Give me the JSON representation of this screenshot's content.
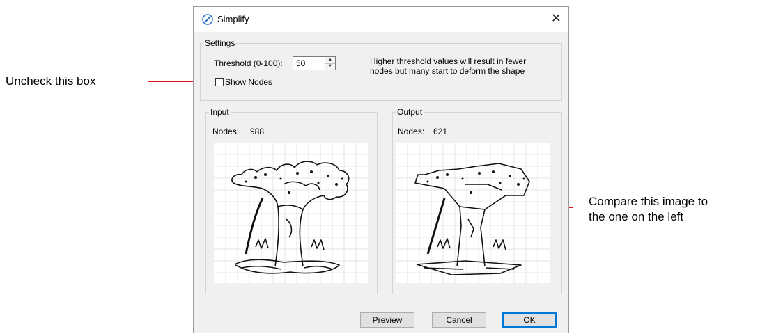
{
  "annotations": {
    "left_callout": "Uncheck this box",
    "right_callout_line1": "Compare this image to",
    "right_callout_line2": "the one on the left"
  },
  "dialog": {
    "title": "Simplify",
    "close_glyph": "✕",
    "title_icon": "compass-icon"
  },
  "settings": {
    "legend": "Settings",
    "threshold_label": "Threshold (0-100):",
    "threshold_value": "50",
    "show_nodes_label": "Show Nodes",
    "show_nodes_checked": false,
    "hint_line1": "Higher threshold values will result in fewer",
    "hint_line2": "nodes but many start to deform the shape"
  },
  "input": {
    "legend": "Input",
    "nodes_label": "Nodes:",
    "nodes_value": "988"
  },
  "output": {
    "legend": "Output",
    "nodes_label": "Nodes:",
    "nodes_value": "621"
  },
  "buttons": {
    "preview": "Preview",
    "cancel": "Cancel",
    "ok": "OK"
  },
  "colors": {
    "arrow": "#e8141b",
    "dialog_bg": "#f0f0f0",
    "ok_border": "#0078d7"
  }
}
